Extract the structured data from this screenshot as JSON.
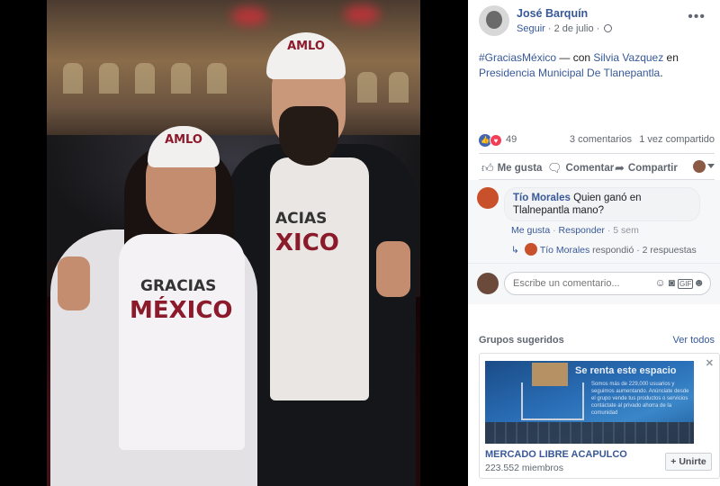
{
  "photo": {
    "man_cap_logo": "AMLO",
    "woman_cap_logo": "AMLO",
    "woman_shirt_line1": "GRACIAS",
    "woman_shirt_line2": "MÉXICO",
    "man_shirt_line1": "ACIAS",
    "man_shirt_line2": "XICO"
  },
  "post": {
    "author": "José Barquín",
    "follow_label": "Seguir",
    "date": "· 2 de julio ·",
    "more_icon": "more-dots-icon",
    "hashtag": "#GraciasMéxico",
    "caption_mid": " — con ",
    "tagged_person": "Silvia Vazquez",
    "caption_en": " en ",
    "place": "Presidencia Municipal De Tlanepantla",
    "caption_end": "."
  },
  "stats": {
    "reactions": "49",
    "comments": "3 comentarios",
    "shares": "1 vez compartido",
    "colors": {
      "like": "#4267b2",
      "love": "#f33e58"
    }
  },
  "actions": {
    "like": "Me gusta",
    "comment": "Comentar",
    "share": "Compartir"
  },
  "comment": {
    "author": "Tío Morales",
    "text": " Quien ganó en Tlalnepantla mano?",
    "like": "Me gusta",
    "reply": "Responder",
    "time": "5 sem",
    "reply_author": "Tío Morales",
    "reply_text": " respondió",
    "reply_count": " · 2 respuestas"
  },
  "compose": {
    "placeholder": "Escribe un comentario...",
    "icons": [
      "emoji-icon",
      "camera-icon",
      "gif-icon",
      "sticker-icon"
    ]
  },
  "groups": {
    "title": "Grupos sugeridos",
    "see_all": "Ver todos",
    "card": {
      "banner": "Se renta este espacio",
      "fine_print": "Somos más de 229,000 usuarios y seguimos aumentando. Anúnciate desde el grupo vende tus productos o servicios contáctate al privado ahorra de la comunidad",
      "name": "MERCADO LIBRE ACAPULCO",
      "members": "223.552 miembros",
      "join": "+ Unirte"
    }
  },
  "accent_color": "#365899"
}
